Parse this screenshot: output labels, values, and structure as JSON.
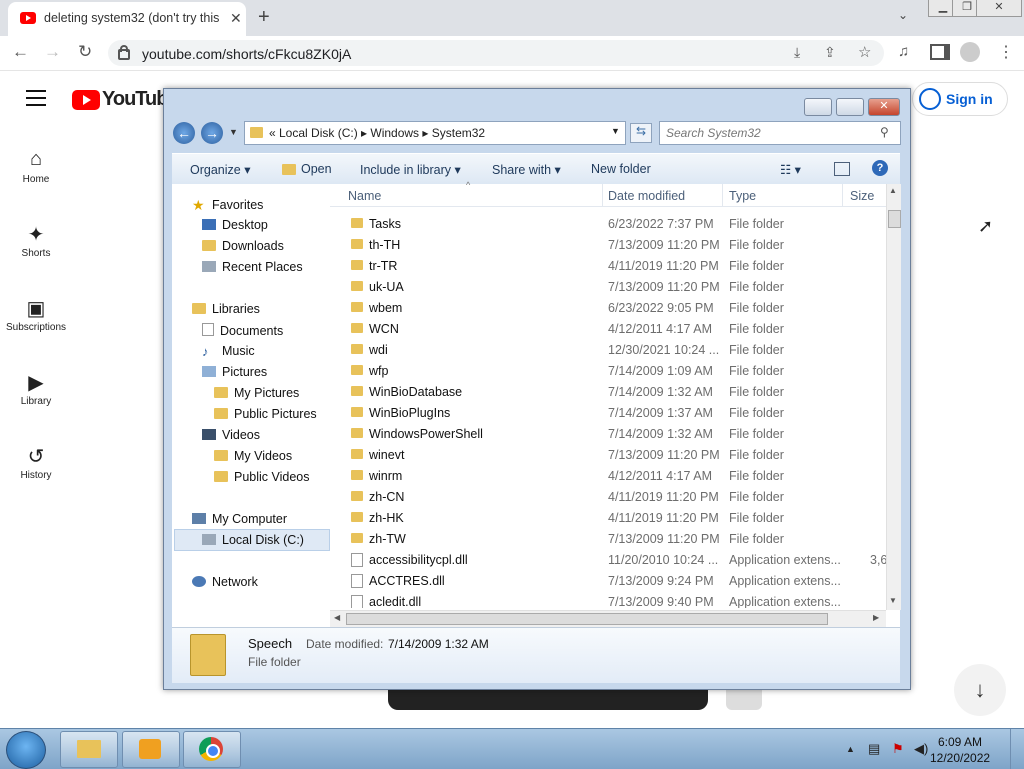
{
  "browser": {
    "tab_title": "deleting system32 (don't try this",
    "tab_close": "✕",
    "new_tab": "+",
    "url": "youtube.com/shorts/cFkcu8ZK0jA"
  },
  "youtube": {
    "logo_text": "YouTube",
    "sidebar": [
      {
        "icon": "⌂",
        "label": "Home"
      },
      {
        "icon": "✦",
        "label": "Shorts"
      },
      {
        "icon": "▣",
        "label": "Subscriptions"
      },
      {
        "icon": "▶",
        "label": "Library"
      },
      {
        "icon": "↺",
        "label": "History"
      }
    ],
    "sign_in": "Sign in",
    "down_arrow": "↓"
  },
  "explorer": {
    "breadcrumb": "«  Local Disk (C:)  ▸  Windows  ▸  System32",
    "search_placeholder": "Search System32",
    "commands": {
      "organize": "Organize ▾",
      "open": "Open",
      "include": "Include in library ▾",
      "share": "Share with ▾",
      "new_folder": "New folder"
    },
    "nav": {
      "favorites": "Favorites",
      "desktop": "Desktop",
      "downloads": "Downloads",
      "recent": "Recent Places",
      "libraries": "Libraries",
      "documents": "Documents",
      "music": "Music",
      "pictures": "Pictures",
      "my_pictures": "My Pictures",
      "public_pictures": "Public Pictures",
      "videos": "Videos",
      "my_videos": "My Videos",
      "public_videos": "Public Videos",
      "computer": "My Computer",
      "local_disk": "Local Disk (C:)",
      "network": "Network"
    },
    "columns": {
      "name": "Name",
      "date": "Date modified",
      "type": "Type",
      "size": "Size"
    },
    "rows": [
      {
        "name": "Tasks",
        "date": "6/23/2022 7:37 PM",
        "type": "File folder",
        "size": "",
        "kind": "folder"
      },
      {
        "name": "th-TH",
        "date": "7/13/2009 11:20 PM",
        "type": "File folder",
        "size": "",
        "kind": "folder"
      },
      {
        "name": "tr-TR",
        "date": "4/11/2019 11:20 PM",
        "type": "File folder",
        "size": "",
        "kind": "folder"
      },
      {
        "name": "uk-UA",
        "date": "7/13/2009 11:20 PM",
        "type": "File folder",
        "size": "",
        "kind": "folder"
      },
      {
        "name": "wbem",
        "date": "6/23/2022 9:05 PM",
        "type": "File folder",
        "size": "",
        "kind": "folder"
      },
      {
        "name": "WCN",
        "date": "4/12/2011 4:17 AM",
        "type": "File folder",
        "size": "",
        "kind": "folder"
      },
      {
        "name": "wdi",
        "date": "12/30/2021 10:24 ...",
        "type": "File folder",
        "size": "",
        "kind": "folder"
      },
      {
        "name": "wfp",
        "date": "7/14/2009 1:09 AM",
        "type": "File folder",
        "size": "",
        "kind": "folder"
      },
      {
        "name": "WinBioDatabase",
        "date": "7/14/2009 1:32 AM",
        "type": "File folder",
        "size": "",
        "kind": "folder"
      },
      {
        "name": "WinBioPlugIns",
        "date": "7/14/2009 1:37 AM",
        "type": "File folder",
        "size": "",
        "kind": "folder"
      },
      {
        "name": "WindowsPowerShell",
        "date": "7/14/2009 1:32 AM",
        "type": "File folder",
        "size": "",
        "kind": "folder"
      },
      {
        "name": "winevt",
        "date": "7/13/2009 11:20 PM",
        "type": "File folder",
        "size": "",
        "kind": "folder"
      },
      {
        "name": "winrm",
        "date": "4/12/2011 4:17 AM",
        "type": "File folder",
        "size": "",
        "kind": "folder"
      },
      {
        "name": "zh-CN",
        "date": "4/11/2019 11:20 PM",
        "type": "File folder",
        "size": "",
        "kind": "folder"
      },
      {
        "name": "zh-HK",
        "date": "4/11/2019 11:20 PM",
        "type": "File folder",
        "size": "",
        "kind": "folder"
      },
      {
        "name": "zh-TW",
        "date": "7/13/2009 11:20 PM",
        "type": "File folder",
        "size": "",
        "kind": "folder"
      },
      {
        "name": "accessibilitycpl.dll",
        "date": "11/20/2010 10:24 ...",
        "type": "Application extens...",
        "size": "3,6",
        "kind": "dll"
      },
      {
        "name": "ACCTRES.dll",
        "date": "7/13/2009 9:24 PM",
        "type": "Application extens...",
        "size": "",
        "kind": "dll"
      },
      {
        "name": "acledit.dll",
        "date": "7/13/2009 9:40 PM",
        "type": "Application extens...",
        "size": "",
        "kind": "dll"
      }
    ],
    "details": {
      "name": "Speech",
      "date_label": "Date modified:",
      "date_value": "7/14/2009 1:32 AM",
      "type": "File folder"
    }
  },
  "taskbar": {
    "time": "6:09 AM",
    "date": "12/20/2022"
  }
}
